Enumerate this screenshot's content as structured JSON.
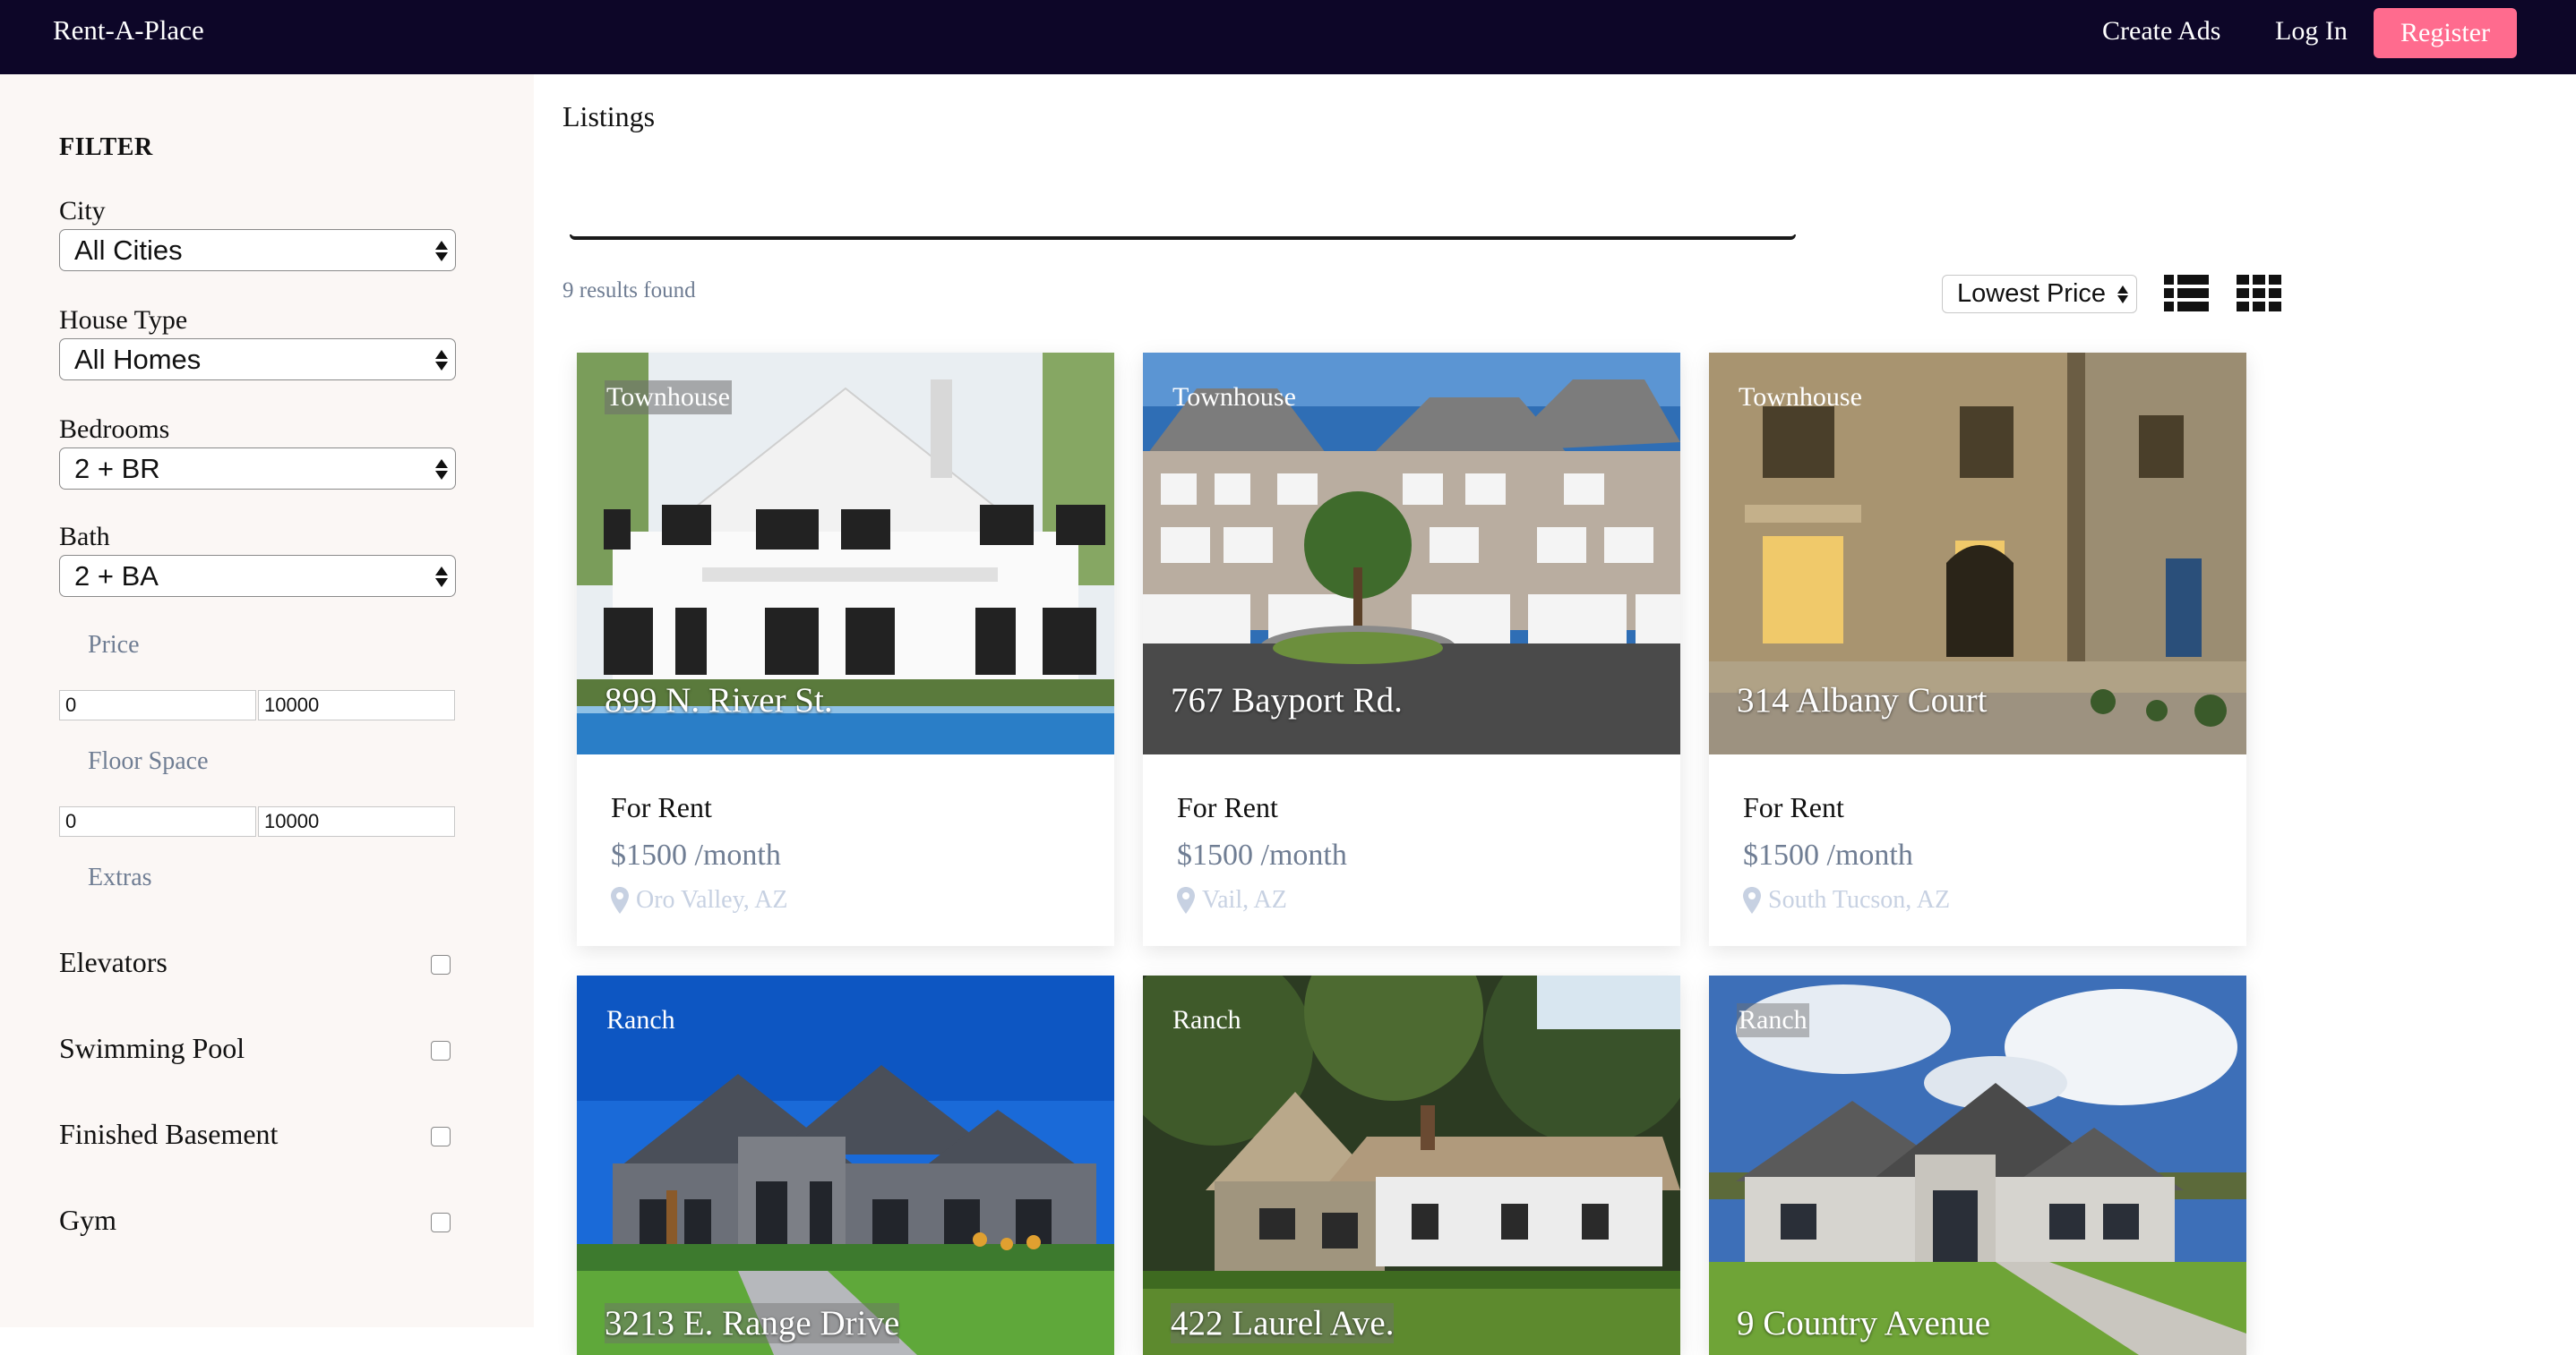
{
  "navbar": {
    "brand": "Rent-A-Place",
    "create_ads": "Create Ads",
    "log_in": "Log In",
    "register": "Register",
    "colors": {
      "bg": "#0d0628",
      "register_bg": "#ff6b8e"
    }
  },
  "sidebar": {
    "title": "FILTER",
    "city": {
      "label": "City",
      "value": "All Cities"
    },
    "house_type": {
      "label": "House Type",
      "value": "All Homes"
    },
    "bedrooms": {
      "label": "Bedrooms",
      "value": "2 + BR"
    },
    "bath": {
      "label": "Bath",
      "value": "2 + BA"
    },
    "price": {
      "label": "Price",
      "min": "0",
      "max": "10000"
    },
    "floor_space": {
      "label": "Floor Space",
      "min": "0",
      "max": "10000"
    },
    "extras": {
      "label": "Extras",
      "items": [
        "Elevators",
        "Swimming Pool",
        "Finished Basement",
        "Gym"
      ]
    }
  },
  "main": {
    "title": "Listings",
    "results": "9 results found",
    "sort": "Lowest Price",
    "icons": {
      "list_view": "list-view-icon",
      "grid_view": "grid-view-icon",
      "location": "map-pin-icon"
    }
  },
  "listings": [
    {
      "type": "Townhouse",
      "address": "899 N. River St.",
      "status": "For Rent",
      "price": "$1500 /month",
      "location": "Oro Valley, AZ"
    },
    {
      "type": "Townhouse",
      "address": "767 Bayport Rd.",
      "status": "For Rent",
      "price": "$1500 /month",
      "location": "Vail, AZ"
    },
    {
      "type": "Townhouse",
      "address": "314 Albany Court",
      "status": "For Rent",
      "price": "$1500 /month",
      "location": "South Tucson, AZ"
    },
    {
      "type": "Ranch",
      "address": "3213 E. Range Drive"
    },
    {
      "type": "Ranch",
      "address": "422 Laurel Ave."
    },
    {
      "type": "Ranch",
      "address": "9 Country Avenue"
    }
  ]
}
